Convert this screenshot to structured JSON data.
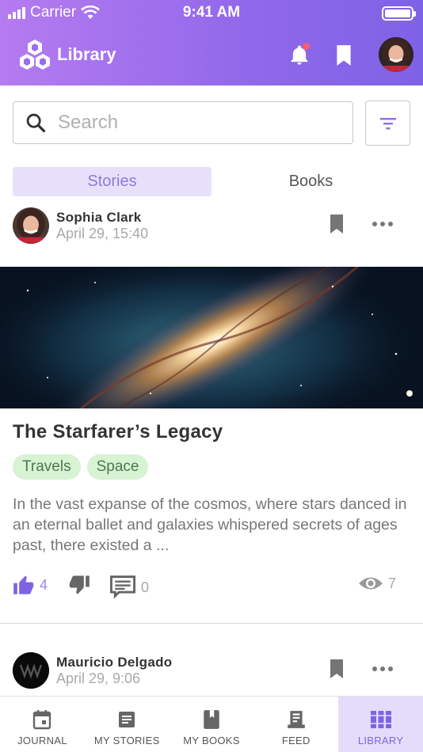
{
  "status_bar": {
    "carrier": "Carrier",
    "time": "9:41 AM"
  },
  "app_bar": {
    "title": "Library",
    "has_notification": true
  },
  "search": {
    "placeholder": "Search",
    "value": ""
  },
  "tabs": [
    {
      "label": "Stories",
      "active": true
    },
    {
      "label": "Books",
      "active": false
    }
  ],
  "posts": [
    {
      "author": "Sophia  Clark",
      "date": "April 29, 15:40",
      "title": "The Starfarer’s Legacy",
      "tags": [
        "Travels",
        "Space"
      ],
      "excerpt": "In the vast expanse of the cosmos, where stars danced in an eternal ballet and galaxies whispered secrets of ages past, there existed a ...",
      "likes": "4",
      "comments": "0",
      "views": "7"
    },
    {
      "author": "Mauricio Delgado",
      "date": "April 29, 9:06"
    }
  ],
  "bottom_nav": [
    {
      "label": "JOURNAL",
      "icon": "calendar-icon",
      "active": false
    },
    {
      "label": "MY STORIES",
      "icon": "article-icon",
      "active": false
    },
    {
      "label": "MY BOOKS",
      "icon": "book-icon",
      "active": false
    },
    {
      "label": "FEED",
      "icon": "feed-icon",
      "active": false
    },
    {
      "label": "LIBRARY",
      "icon": "library-icon",
      "active": true
    }
  ],
  "colors": {
    "accent": "#8e6ee8",
    "tab_active_bg": "#e7e0fb",
    "tag_bg": "#d7f3d4",
    "like_active": "#7d63e4"
  }
}
